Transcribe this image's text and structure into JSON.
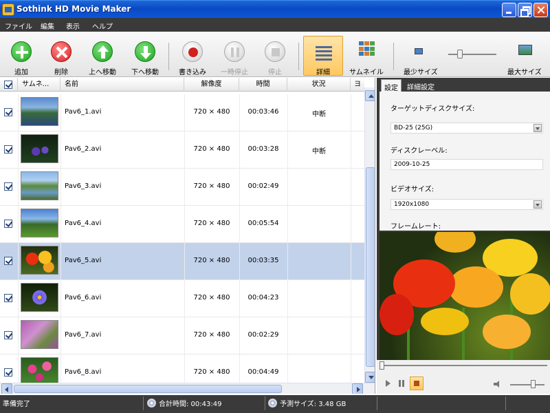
{
  "window": {
    "title": "Sothink HD Movie Maker"
  },
  "menu": [
    "ファイル",
    "編集",
    "表示",
    "ヘルプ"
  ],
  "toolbar": {
    "add": "追加",
    "delete": "削除",
    "move_up": "上へ移動",
    "move_down": "下へ移動",
    "burn": "書き込み",
    "pause": "一時停止",
    "stop": "停止",
    "detail": "詳細",
    "thumbnail": "サムネイル",
    "min_size": "最少サイズ",
    "max_size": "最大サイズ"
  },
  "list": {
    "columns": {
      "thumbnail": "サムネ...",
      "name": "名前",
      "resolution": "解像度",
      "time": "時間",
      "status": "状況",
      "extra": "ヨ"
    },
    "rows": [
      {
        "name": "Pav6_1.avi",
        "resolution": "720 × 480",
        "time": "00:03:46",
        "status": "中断",
        "checked": true,
        "selected": false,
        "thumb": "lake"
      },
      {
        "name": "Pav6_2.avi",
        "resolution": "720 × 480",
        "time": "00:03:28",
        "status": "中断",
        "checked": true,
        "selected": false,
        "thumb": "lupine"
      },
      {
        "name": "Pav6_3.avi",
        "resolution": "720 × 480",
        "time": "00:02:49",
        "status": "",
        "checked": true,
        "selected": false,
        "thumb": "river"
      },
      {
        "name": "Pav6_4.avi",
        "resolution": "720 × 480",
        "time": "00:05:54",
        "status": "",
        "checked": true,
        "selected": false,
        "thumb": "meadow"
      },
      {
        "name": "Pav6_5.avi",
        "resolution": "720 × 480",
        "time": "00:03:35",
        "status": "",
        "checked": true,
        "selected": true,
        "thumb": "poppies"
      },
      {
        "name": "Pav6_6.avi",
        "resolution": "720 × 480",
        "time": "00:04:23",
        "status": "",
        "checked": true,
        "selected": false,
        "thumb": "aster"
      },
      {
        "name": "Pav6_7.avi",
        "resolution": "720 × 480",
        "time": "00:02:29",
        "status": "",
        "checked": true,
        "selected": false,
        "thumb": "heather"
      },
      {
        "name": "Pav6_8.avi",
        "resolution": "720 × 480",
        "time": "00:04:49",
        "status": "",
        "checked": true,
        "selected": false,
        "thumb": "pinks"
      }
    ]
  },
  "settings": {
    "tabs": [
      "設定",
      "詳細設定"
    ],
    "target_disc_label": "ターゲットディスクサイズ:",
    "target_disc_value": "BD-25 (25G)",
    "disc_label_label": "ディスクレーベル:",
    "disc_label_value": "2009-10-25",
    "video_size_label": "ビデオサイズ:",
    "video_size_value": "1920x1080",
    "frame_rate_label": "フレームレート:"
  },
  "status": {
    "ready": "準備完了",
    "total_time": "合計時間: 00:43:49",
    "estimated_size": "予測サイズ: 3.48 GB"
  },
  "colors": {
    "title_bar": "#0a4ac4",
    "selection": "#c2d2ea",
    "accent": "#ffc860"
  }
}
